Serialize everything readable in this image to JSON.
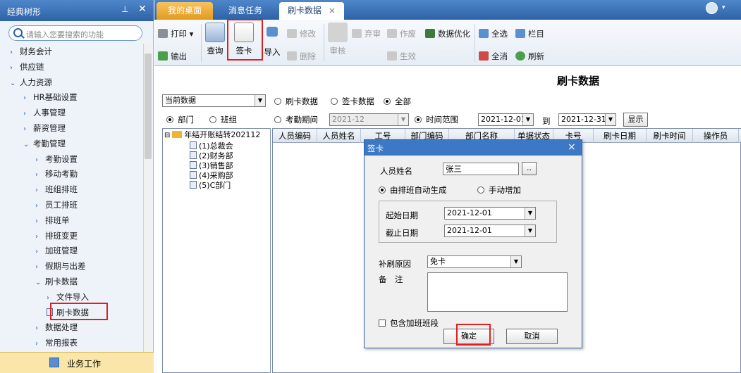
{
  "sidebar": {
    "title": "经典树形",
    "search_placeholder": "请输入您要搜索的功能",
    "items": [
      {
        "label": "财务会计",
        "arrow": "›"
      },
      {
        "label": "供应链",
        "arrow": "›"
      },
      {
        "label": "人力资源",
        "arrow": "⌄"
      },
      {
        "label": "HR基础设置",
        "arrow": "›"
      },
      {
        "label": "人事管理",
        "arrow": "›"
      },
      {
        "label": "薪资管理",
        "arrow": "›"
      },
      {
        "label": "考勤管理",
        "arrow": "⌄"
      },
      {
        "label": "考勤设置",
        "arrow": "›"
      },
      {
        "label": "移动考勤",
        "arrow": "›"
      },
      {
        "label": "班组排班",
        "arrow": "›"
      },
      {
        "label": "员工排班",
        "arrow": "›"
      },
      {
        "label": "排班单",
        "arrow": "›"
      },
      {
        "label": "排班变更",
        "arrow": "›"
      },
      {
        "label": "加班管理",
        "arrow": "›"
      },
      {
        "label": "假期与出差",
        "arrow": "›"
      },
      {
        "label": "刷卡数据",
        "arrow": "⌄"
      },
      {
        "label": "文件导入",
        "arrow": "›"
      },
      {
        "label": "刷卡数据",
        "arrow": ""
      },
      {
        "label": "数据处理",
        "arrow": "›"
      },
      {
        "label": "常用报表",
        "arrow": "›"
      }
    ],
    "bottom_label": "业务工作"
  },
  "tabs": [
    "我的桌面",
    "消息任务",
    "刷卡数据"
  ],
  "tab_close": "×",
  "toolbar": {
    "print": "打印",
    "export": "输出",
    "query": "查询",
    "sign": "签卡",
    "import": "导入",
    "modify": "修改",
    "delete": "删除",
    "audit": "审核",
    "abandon": "弃审",
    "void": "作废",
    "effective": "生效",
    "optimize": "数据优化",
    "select_all": "全选",
    "deselect_all": "全消",
    "columns": "栏目",
    "refresh": "刷新"
  },
  "page_title": "刷卡数据",
  "filter": {
    "data_select": "当前数据",
    "radio_card": "刷卡数据",
    "radio_sign": "签卡数据",
    "radio_all": "全部",
    "radio_dept": "部门",
    "radio_group": "班组",
    "radio_period": "考勤期间",
    "period_value": "2021-12",
    "radio_range": "时间范围",
    "date_from": "2021-12-01",
    "to_label": "到",
    "date_to": "2021-12-31",
    "show_button": "显示"
  },
  "org_tree": {
    "root": "年结开账结转202112",
    "children": [
      "(1)总裁会",
      "(2)财务部",
      "(3)销售部",
      "(4)采购部",
      "(5)C部门"
    ]
  },
  "grid_headers": [
    "人员编码",
    "人员姓名",
    "工号",
    "部门编码",
    "部门名称",
    "单据状态",
    "卡号",
    "刷卡日期",
    "刷卡时间",
    "操作员"
  ],
  "dialog": {
    "title": "签卡",
    "close": "×",
    "name_label": "人员姓名",
    "name_value": "张三",
    "browse_button": "..",
    "radio_auto": "由排班自动生成",
    "radio_manual": "手动增加",
    "start_label": "起始日期",
    "start_value": "2021-12-01",
    "end_label": "截止日期",
    "end_value": "2021-12-01",
    "reason_label": "补刷原因",
    "reason_value": "免卡",
    "remark_label": "备　注",
    "overtime_label": "包含加班班段",
    "ok": "确定",
    "cancel": "取消"
  },
  "colors": {
    "accent": "#2e62a8",
    "home_tab": "#e29a1e",
    "highlight": "#e02020"
  }
}
